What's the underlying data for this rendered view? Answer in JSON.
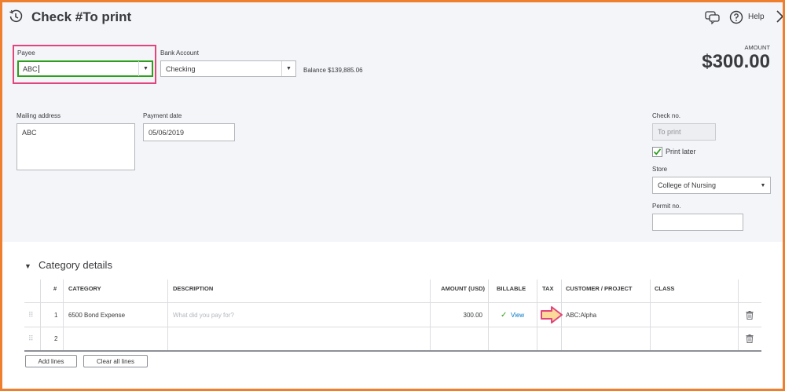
{
  "header": {
    "history_icon": "clock-history-icon",
    "title": "Check #To print",
    "feedback_icon": "chat-feedback-icon",
    "help_icon": "question-circle-icon",
    "help_label": "Help",
    "close_icon": "chevron-right-icon"
  },
  "payee": {
    "label": "Payee",
    "value": "ABC"
  },
  "bank_account": {
    "label": "Bank Account",
    "value": "Checking",
    "balance": "Balance $139,885.06"
  },
  "amount": {
    "label": "AMOUNT",
    "value": "$300.00"
  },
  "mailing_address": {
    "label": "Mailing address",
    "value": "ABC"
  },
  "payment_date": {
    "label": "Payment date",
    "value": "05/06/2019"
  },
  "check_no": {
    "label": "Check no.",
    "value": "To print"
  },
  "print_later": {
    "label": "Print later",
    "checked": true
  },
  "store": {
    "label": "Store",
    "value": "College of Nursing"
  },
  "permit_no": {
    "label": "Permit no.",
    "value": ""
  },
  "category_details": {
    "title": "Category details",
    "columns": [
      "#",
      "CATEGORY",
      "DESCRIPTION",
      "AMOUNT (USD)",
      "BILLABLE",
      "TAX",
      "CUSTOMER / PROJECT",
      "CLASS"
    ],
    "rows": [
      {
        "num": "1",
        "category": "6500 Bond Expense",
        "description_placeholder": "What did you pay for?",
        "amount": "300.00",
        "billable": "View",
        "tax": "",
        "customer": "ABC:Alpha",
        "class": ""
      },
      {
        "num": "2",
        "category": "",
        "description_placeholder": "",
        "amount": "",
        "billable": "",
        "tax": "",
        "customer": "",
        "class": ""
      }
    ],
    "add_lines": "Add lines",
    "clear_all_lines": "Clear all lines"
  },
  "colors": {
    "frame": "#ee7f2f",
    "highlight": "#e0457b",
    "focus_green": "#2ca01c",
    "arrow_fill": "#fcd899",
    "link": "#0077c5"
  }
}
